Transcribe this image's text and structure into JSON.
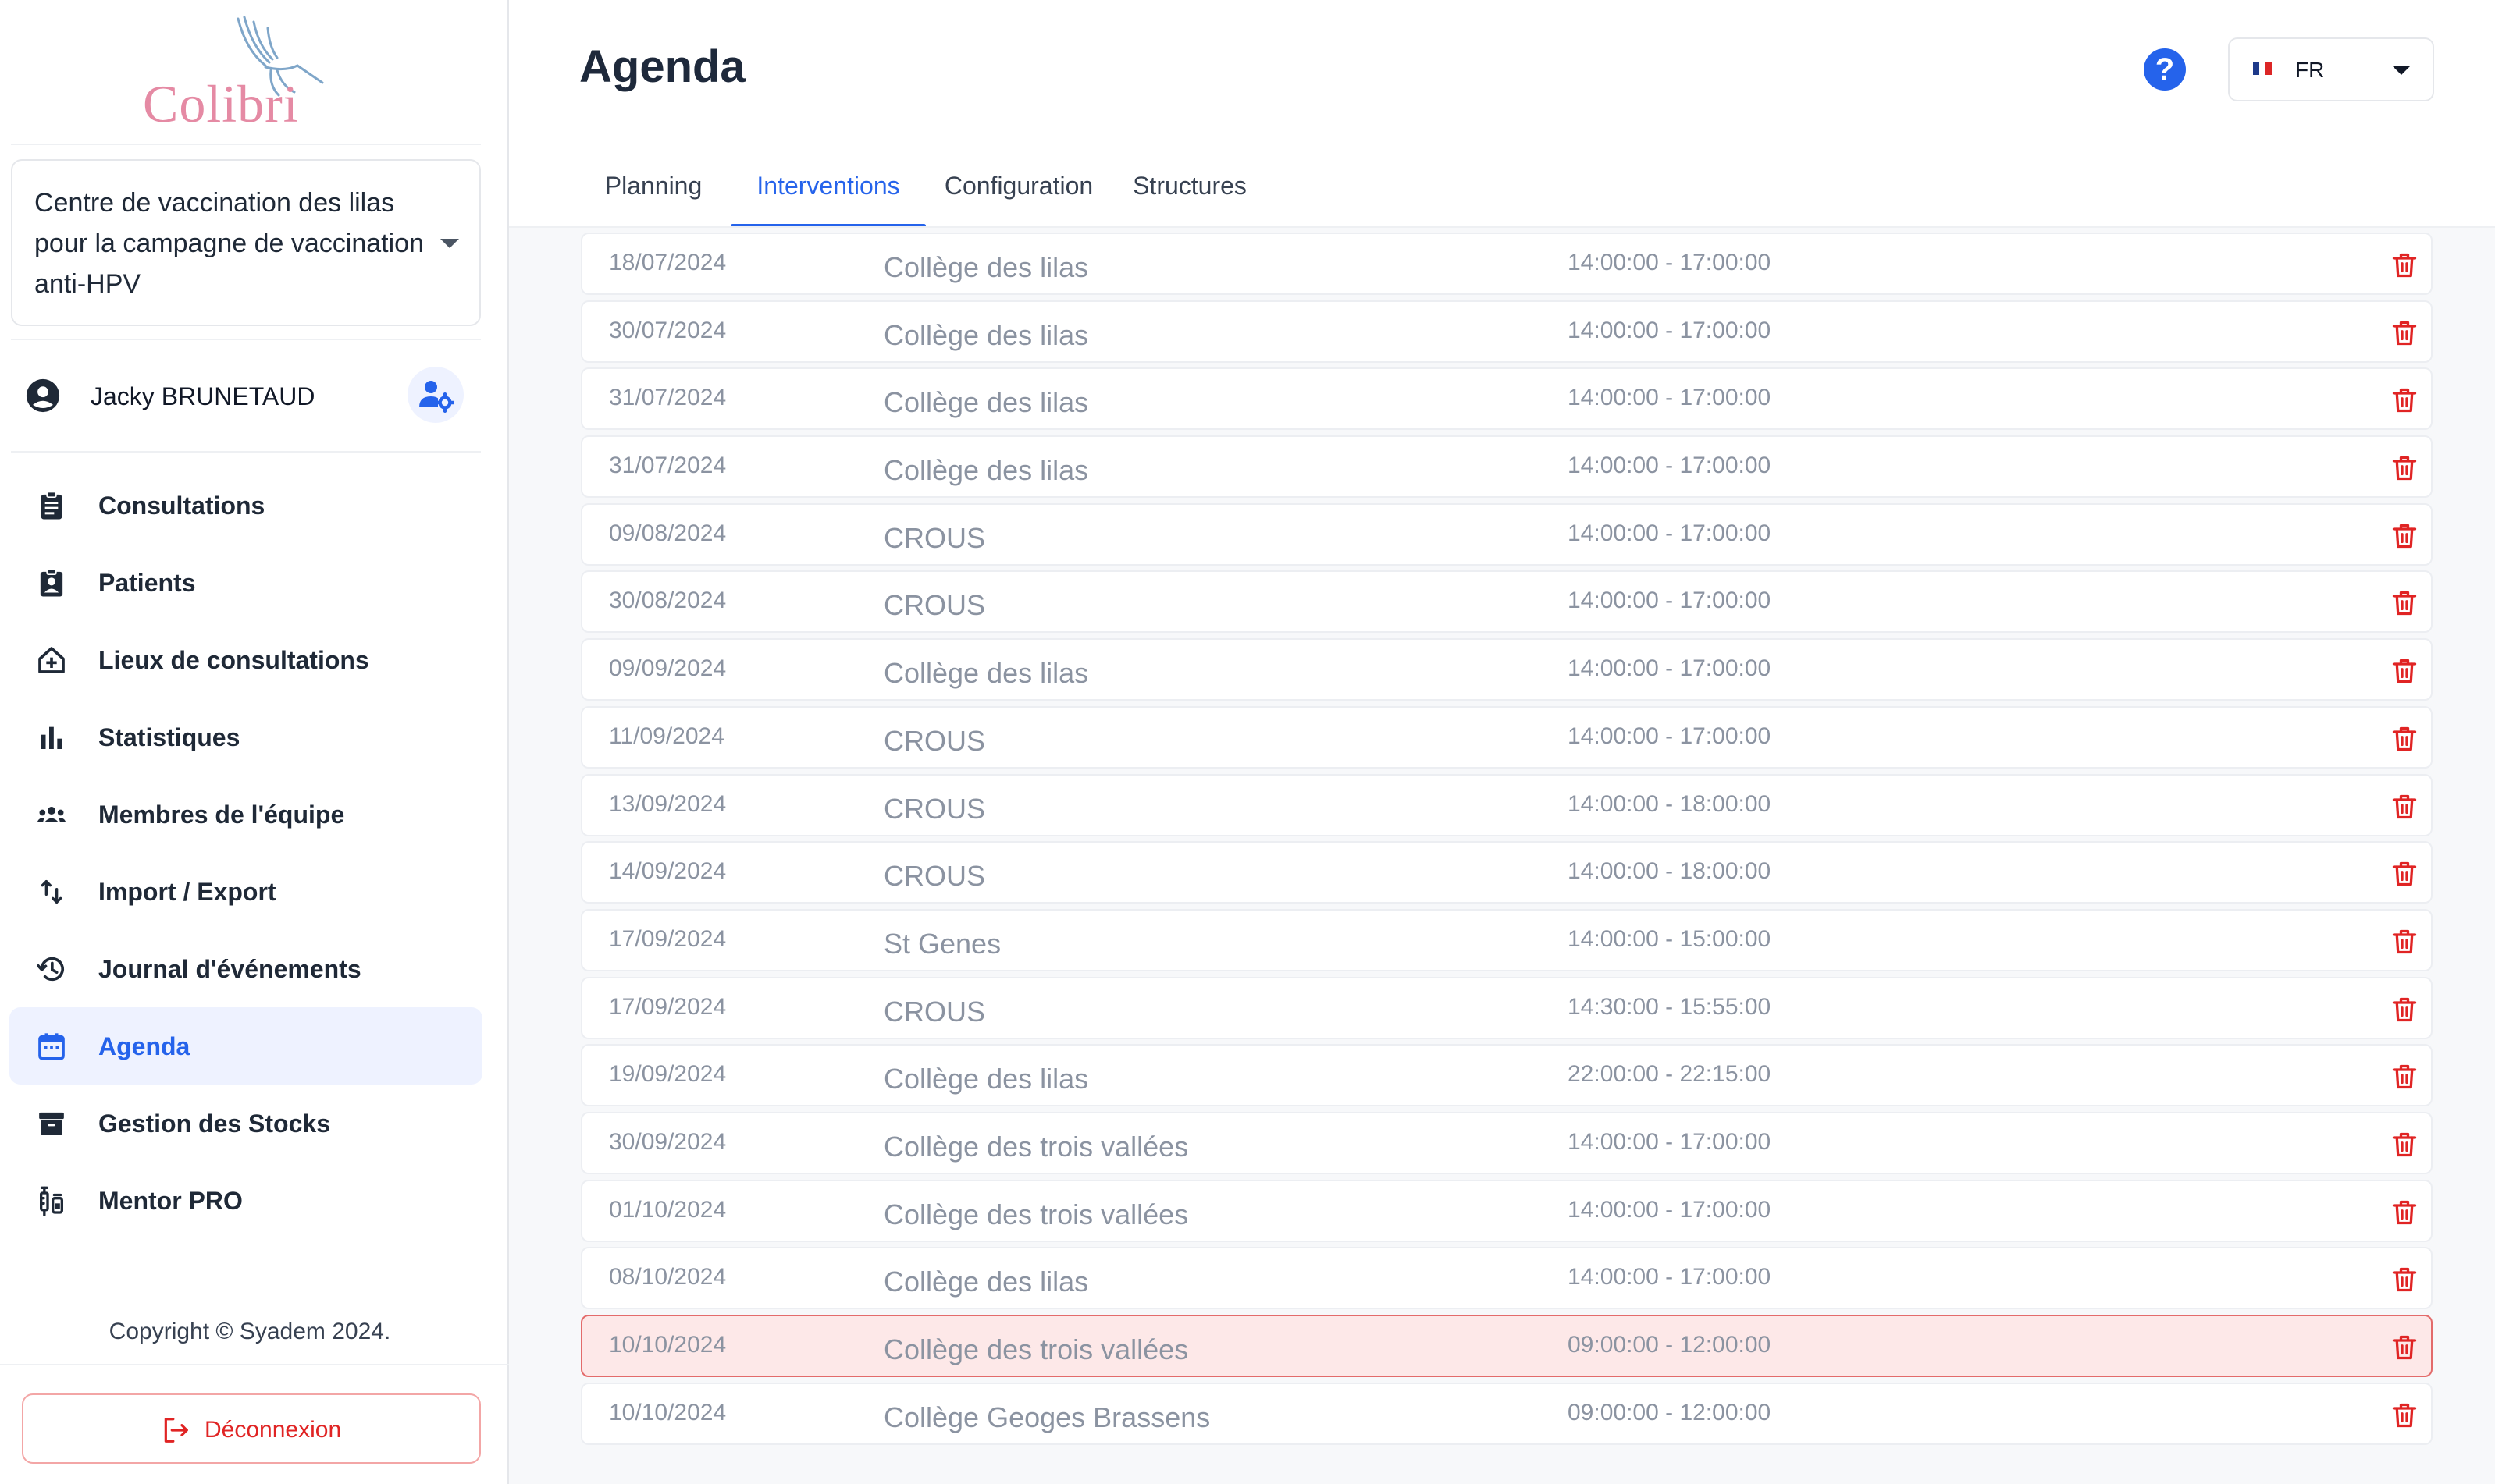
{
  "app": {
    "logo_text": "Colibri",
    "center_name": "Centre de vaccination des lilas pour la campagne de vaccination anti-HPV",
    "user_name": "Jacky BRUNETAUD",
    "copyright": "Copyright © Syadem 2024.",
    "logout_label": "Déconnexion"
  },
  "nav": [
    {
      "label": "Consultations",
      "icon": "clipboard-icon"
    },
    {
      "label": "Patients",
      "icon": "patient-badge-icon"
    },
    {
      "label": "Lieux de consultations",
      "icon": "home-plus-icon"
    },
    {
      "label": "Statistiques",
      "icon": "bar-chart-icon"
    },
    {
      "label": "Membres de l'équipe",
      "icon": "team-icon"
    },
    {
      "label": "Import / Export",
      "icon": "swap-vertical-icon"
    },
    {
      "label": "Journal d'événements",
      "icon": "history-icon"
    },
    {
      "label": "Agenda",
      "icon": "calendar-icon",
      "active": true
    },
    {
      "label": "Gestion des Stocks",
      "icon": "archive-icon"
    },
    {
      "label": "Mentor PRO",
      "icon": "syringe-icon"
    }
  ],
  "header": {
    "title": "Agenda",
    "help_symbol": "?",
    "language": "FR"
  },
  "tabs": [
    {
      "label": "Planning"
    },
    {
      "label": "Interventions",
      "active": true
    },
    {
      "label": "Configuration"
    },
    {
      "label": "Structures"
    }
  ],
  "interventions": [
    {
      "date": "18/07/2024",
      "place": "Collège des lilas",
      "time": "14:00:00 - 17:00:00"
    },
    {
      "date": "30/07/2024",
      "place": "Collège des lilas",
      "time": "14:00:00 - 17:00:00"
    },
    {
      "date": "31/07/2024",
      "place": "Collège des lilas",
      "time": "14:00:00 - 17:00:00"
    },
    {
      "date": "31/07/2024",
      "place": "Collège des lilas",
      "time": "14:00:00 - 17:00:00"
    },
    {
      "date": "09/08/2024",
      "place": "CROUS",
      "time": "14:00:00 - 17:00:00"
    },
    {
      "date": "30/08/2024",
      "place": "CROUS",
      "time": "14:00:00 - 17:00:00"
    },
    {
      "date": "09/09/2024",
      "place": "Collège des lilas",
      "time": "14:00:00 - 17:00:00"
    },
    {
      "date": "11/09/2024",
      "place": "CROUS",
      "time": "14:00:00 - 17:00:00"
    },
    {
      "date": "13/09/2024",
      "place": "CROUS",
      "time": "14:00:00 - 18:00:00"
    },
    {
      "date": "14/09/2024",
      "place": "CROUS",
      "time": "14:00:00 - 18:00:00"
    },
    {
      "date": "17/09/2024",
      "place": "St Genes",
      "time": "14:00:00 - 15:00:00"
    },
    {
      "date": "17/09/2024",
      "place": "CROUS",
      "time": "14:30:00 - 15:55:00"
    },
    {
      "date": "19/09/2024",
      "place": "Collège des lilas",
      "time": "22:00:00 - 22:15:00"
    },
    {
      "date": "30/09/2024",
      "place": "Collège des trois vallées",
      "time": "14:00:00 - 17:00:00"
    },
    {
      "date": "01/10/2024",
      "place": "Collège des trois vallées",
      "time": "14:00:00 - 17:00:00"
    },
    {
      "date": "08/10/2024",
      "place": "Collège des lilas",
      "time": "14:00:00 - 17:00:00"
    },
    {
      "date": "10/10/2024",
      "place": "Collège des trois vallées",
      "time": "09:00:00 - 12:00:00",
      "highlighted": true
    },
    {
      "date": "10/10/2024",
      "place": "Collège Geoges Brassens",
      "time": "09:00:00 - 12:00:00"
    }
  ],
  "colors": {
    "accent": "#2563eb",
    "danger": "#e02424",
    "highlight_bg": "#fde8e8",
    "logo_pink": "#e58aa4"
  }
}
